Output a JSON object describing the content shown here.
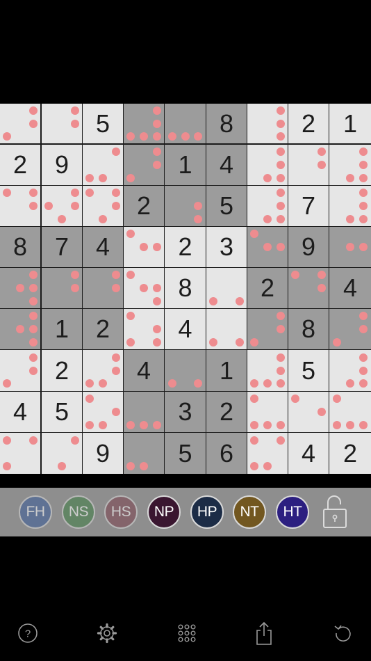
{
  "board": {
    "rows": [
      [
        "",
        "",
        "5",
        "",
        "",
        "8",
        "",
        "2",
        "1"
      ],
      [
        "2",
        "9",
        "",
        "",
        "1",
        "4",
        "",
        "",
        ""
      ],
      [
        "",
        "",
        "",
        "2",
        "",
        "5",
        "",
        "7",
        ""
      ],
      [
        "8",
        "7",
        "4",
        "",
        "2",
        "3",
        "",
        "9",
        ""
      ],
      [
        "",
        "",
        "",
        "",
        "8",
        "",
        "2",
        "",
        "4"
      ],
      [
        "",
        "1",
        "2",
        "",
        "4",
        "",
        "",
        "8",
        ""
      ],
      [
        "",
        "2",
        "",
        "4",
        "",
        "1",
        "",
        "5",
        ""
      ],
      [
        "4",
        "5",
        "",
        "",
        "3",
        "2",
        "",
        "",
        ""
      ],
      [
        "",
        "",
        "9",
        "",
        "5",
        "6",
        "",
        "4",
        "2"
      ]
    ],
    "candidates": [
      [
        [
          3,
          6,
          7
        ],
        [
          3,
          6
        ],
        [],
        [
          3,
          6,
          7,
          8,
          9
        ],
        [
          7,
          8,
          9
        ],
        [],
        [
          3,
          6,
          9
        ],
        [],
        []
      ],
      [
        [],
        [],
        [
          3,
          7,
          8
        ],
        [
          3,
          6,
          7
        ],
        [],
        [],
        [
          3,
          6,
          8,
          9
        ],
        [
          3,
          6
        ],
        [
          3,
          6,
          8,
          9
        ]
      ],
      [
        [
          1,
          3,
          6
        ],
        [
          3,
          4,
          6,
          8
        ],
        [
          1,
          3,
          6,
          8
        ],
        [],
        [
          6,
          9
        ],
        [],
        [
          3,
          6,
          8,
          9
        ],
        [],
        [
          3,
          6,
          8,
          9
        ]
      ],
      [
        [],
        [],
        [],
        [
          1,
          5,
          6
        ],
        [],
        [],
        [
          1,
          5,
          6
        ],
        [],
        [
          5,
          6
        ]
      ],
      [
        [
          3,
          5,
          6,
          9
        ],
        [
          3,
          6
        ],
        [
          3,
          6
        ],
        [
          1,
          5,
          6,
          9
        ],
        [],
        [
          7,
          9
        ],
        [],
        [
          1,
          3,
          6
        ],
        []
      ],
      [
        [
          3,
          5,
          6,
          9
        ],
        [],
        [],
        [
          1,
          6,
          7,
          9
        ],
        [],
        [
          7,
          9
        ],
        [
          3,
          6,
          7
        ],
        [],
        [
          3,
          6,
          7
        ]
      ],
      [
        [
          3,
          6,
          7
        ],
        [],
        [
          3,
          6,
          7,
          8
        ],
        [],
        [
          7,
          9
        ],
        [],
        [
          3,
          6,
          7,
          8,
          9
        ],
        [],
        [
          3,
          6,
          8,
          9
        ]
      ],
      [
        [],
        [],
        [
          1,
          6,
          7,
          8
        ],
        [
          7,
          8,
          9
        ],
        [],
        [],
        [
          1,
          7,
          8,
          9
        ],
        [
          1,
          6
        ],
        [
          1,
          7,
          8,
          9
        ]
      ],
      [
        [
          1,
          3,
          7
        ],
        [
          3,
          8
        ],
        [],
        [
          7,
          8
        ],
        [],
        [],
        [
          1,
          3,
          7,
          8
        ],
        [],
        []
      ]
    ],
    "shaded_boxes": [
      [
        0,
        1
      ],
      [
        1,
        0
      ],
      [
        1,
        2
      ],
      [
        2,
        1
      ]
    ],
    "colors": {
      "light_cell": "#e6e6e6",
      "dark_cell": "#9c9c9c",
      "candidate": "#ee8c8f",
      "digit": "#1c1c1c"
    }
  },
  "toolbar": {
    "buttons": [
      {
        "label": "FH",
        "color": "#3a5c99",
        "faded": true
      },
      {
        "label": "NS",
        "color": "#3f7f45",
        "faded": true
      },
      {
        "label": "HS",
        "color": "#7d4350",
        "faded": true
      },
      {
        "label": "NP",
        "color": "#3a1630",
        "faded": false
      },
      {
        "label": "HP",
        "color": "#1c2c46",
        "faded": false
      },
      {
        "label": "NT",
        "color": "#725720",
        "faded": false
      },
      {
        "label": "HT",
        "color": "#2c1f80",
        "faded": false
      }
    ],
    "lock_icon": "lock-open-icon"
  },
  "bottom_bar": {
    "icons": [
      "help-icon",
      "settings-gear-icon",
      "candidates-grid-icon",
      "share-icon",
      "undo-icon"
    ]
  }
}
